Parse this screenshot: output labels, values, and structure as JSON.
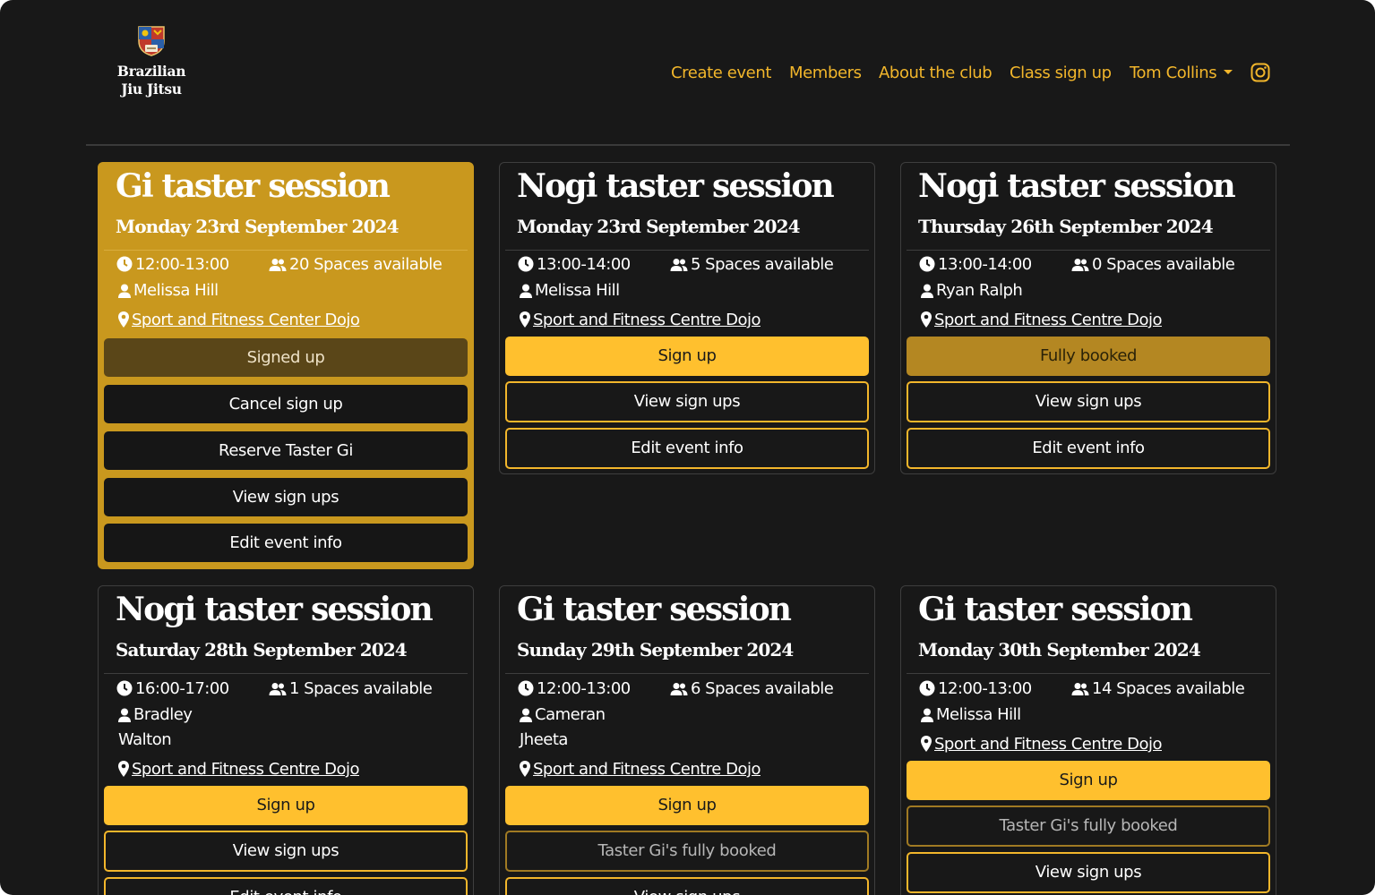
{
  "header": {
    "logo_text": "Brazilian\nJiu Jitsu",
    "nav": [
      {
        "label": "Create event"
      },
      {
        "label": "Members"
      },
      {
        "label": "About the club"
      },
      {
        "label": "Class sign up"
      },
      {
        "label": "Tom Collins"
      }
    ],
    "instagram_icon": "instagram-icon"
  },
  "colors": {
    "accent": "#ffc02e",
    "accent_dark": "#c9981e",
    "link": "#f2b62b",
    "background": "#181818"
  },
  "events": [
    {
      "title": "Gi taster session",
      "date": "Monday 23rd September 2024",
      "time": "12:00-13:00",
      "spaces": "20 Spaces available",
      "instructor": "Melissa Hill",
      "location": "Sport and Fitness Center Dojo",
      "buttons": [
        {
          "label": "Signed up"
        },
        {
          "label": "Cancel sign up"
        },
        {
          "label": "Reserve Taster Gi"
        },
        {
          "label": "View sign ups"
        },
        {
          "label": "Edit event info"
        }
      ]
    },
    {
      "title": "Nogi taster session",
      "date": "Monday 23rd September 2024",
      "time": "13:00-14:00",
      "spaces": "5 Spaces available",
      "instructor": "Melissa Hill",
      "location": "Sport and Fitness Centre Dojo",
      "buttons": [
        {
          "label": "Sign up"
        },
        {
          "label": "View sign ups"
        },
        {
          "label": "Edit event info"
        }
      ]
    },
    {
      "title": "Nogi taster session",
      "date": "Thursday 26th September 2024",
      "time": "13:00-14:00",
      "spaces": "0 Spaces available",
      "instructor": "Ryan Ralph",
      "location": "Sport and Fitness Centre Dojo",
      "buttons": [
        {
          "label": "Fully booked"
        },
        {
          "label": "View sign ups"
        },
        {
          "label": "Edit event info"
        }
      ]
    },
    {
      "title": "Nogi taster session",
      "date": "Saturday 28th September 2024",
      "time": "16:00-17:00",
      "spaces": "1 Spaces available",
      "instructor": "Bradley Walton",
      "location": "Sport and Fitness Centre Dojo",
      "buttons": [
        {
          "label": "Sign up"
        },
        {
          "label": "View sign ups"
        },
        {
          "label": "Edit event info"
        }
      ]
    },
    {
      "title": "Gi taster session",
      "date": "Sunday 29th September 2024",
      "time": "12:00-13:00",
      "spaces": "6 Spaces available",
      "instructor": "Cameran Jheeta",
      "location": "Sport and Fitness Centre Dojo",
      "buttons": [
        {
          "label": "Sign up"
        },
        {
          "label": "Taster Gi's fully booked"
        },
        {
          "label": "View sign ups"
        }
      ]
    },
    {
      "title": "Gi taster session",
      "date": "Monday 30th September 2024",
      "time": "12:00-13:00",
      "spaces": "14 Spaces available",
      "instructor": "Melissa Hill",
      "location": "Sport and Fitness Centre Dojo",
      "buttons": [
        {
          "label": "Sign up"
        },
        {
          "label": "Taster Gi's fully booked"
        },
        {
          "label": "View sign ups"
        }
      ]
    }
  ]
}
